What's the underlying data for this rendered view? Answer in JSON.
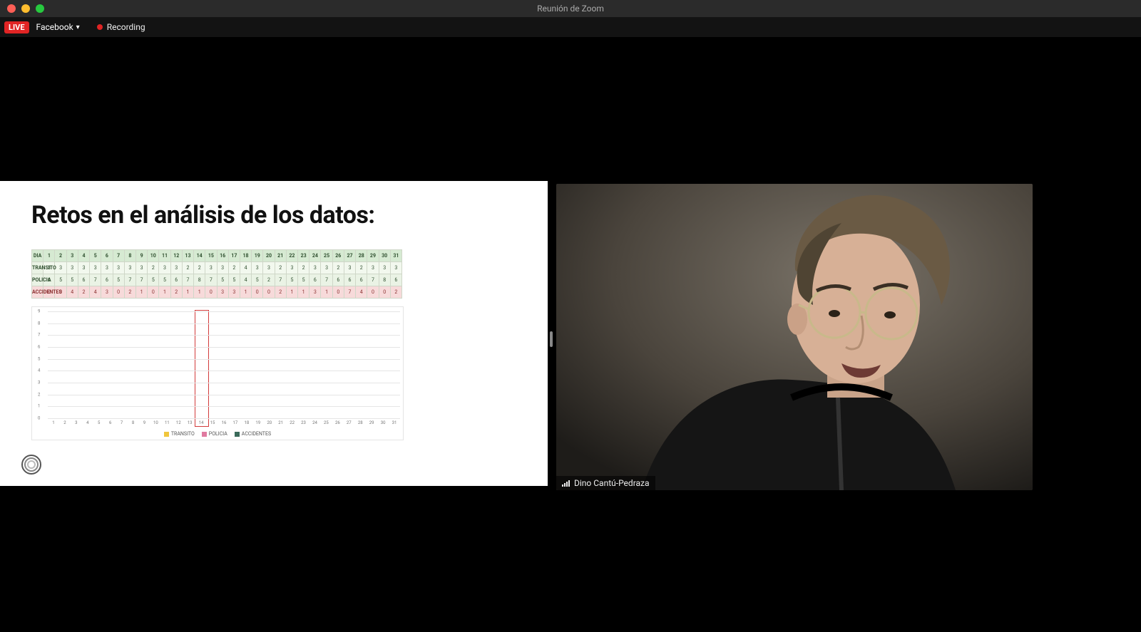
{
  "window": {
    "title": "Reunión de Zoom"
  },
  "topstrip": {
    "live_label": "LIVE",
    "stream_target": "Facebook",
    "recording_label": "Recording"
  },
  "slide": {
    "title": "Retos en el análisis de los datos:",
    "table": {
      "header_label": "DIA",
      "row_labels": [
        "TRANSITO",
        "POLICIA",
        "ACCIDENTES"
      ]
    }
  },
  "speaker": {
    "name": "Dino Cantú-Pedraza"
  },
  "chart_data": {
    "type": "bar",
    "title": "",
    "xlabel": "",
    "ylabel": "",
    "ylim": [
      0,
      9
    ],
    "yticks": [
      0,
      1,
      2,
      3,
      4,
      5,
      6,
      7,
      8,
      9
    ],
    "categories": [
      1,
      2,
      3,
      4,
      5,
      6,
      7,
      8,
      9,
      10,
      11,
      12,
      13,
      14,
      15,
      16,
      17,
      18,
      19,
      20,
      21,
      22,
      23,
      24,
      25,
      26,
      27,
      28,
      29,
      30,
      31
    ],
    "series": [
      {
        "name": "TRANSITO",
        "color": "#f0c63d",
        "values": [
          3,
          3,
          3,
          3,
          3,
          3,
          3,
          3,
          3,
          2,
          3,
          3,
          2,
          2,
          3,
          3,
          2,
          4,
          3,
          3,
          2,
          3,
          2,
          3,
          3,
          2,
          3,
          2,
          3,
          3,
          3
        ]
      },
      {
        "name": "POLICIA",
        "color": "#e07aa0",
        "values": [
          6,
          5,
          5,
          6,
          7,
          6,
          5,
          7,
          7,
          5,
          5,
          6,
          7,
          8,
          7,
          5,
          5,
          4,
          5,
          2,
          7,
          5,
          5,
          6,
          7,
          6,
          6,
          6,
          7,
          8,
          6
        ]
      },
      {
        "name": "ACCIDENTES",
        "color": "#3a6a5a",
        "values": [
          0,
          0,
          4,
          2,
          4,
          3,
          0,
          2,
          1,
          0,
          1,
          2,
          1,
          1,
          0,
          3,
          3,
          1,
          0,
          0,
          2,
          1,
          1,
          3,
          1,
          0,
          7,
          4,
          0,
          0,
          2
        ]
      }
    ],
    "highlight_index": 13,
    "legend": [
      "TRANSITO",
      "POLICIA",
      "ACCIDENTES"
    ]
  }
}
